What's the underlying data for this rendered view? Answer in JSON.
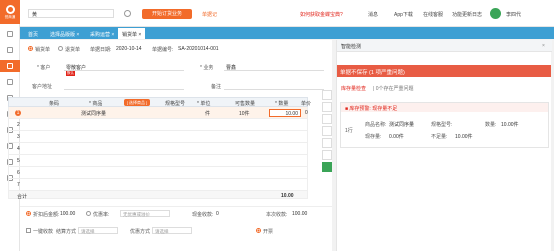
{
  "app": {
    "logo_text": "悦商通"
  },
  "topbar": {
    "search_value": "黄",
    "primary_button": "开始订货业务",
    "secondary_link": "单据记",
    "items": [
      {
        "label": "如何获取金蝶宝典?",
        "red": true
      },
      {
        "label": "消息"
      },
      {
        "label": "App下载"
      },
      {
        "label": "在线客服"
      },
      {
        "label": "功能更新日志"
      }
    ],
    "user_name": "李四代"
  },
  "tabs": [
    {
      "label": "首页",
      "active": false
    },
    {
      "label": "选择品版版 ×",
      "active": false
    },
    {
      "label": "采购运营 ×",
      "active": false
    },
    {
      "label": "销货单 ×",
      "active": true
    }
  ],
  "form": {
    "type_options": [
      {
        "label": "销货单",
        "selected": true
      },
      {
        "label": "退货单",
        "selected": false
      }
    ],
    "date_label": "单据日期:",
    "date_value": "2020-10-14",
    "number_label": "单据编号:",
    "number_value": "SA-20201014-001",
    "customer_label": "* 客户",
    "customer_value": "零散客户",
    "customer_badge": "默认",
    "salesperson_label": "* 业务",
    "salesperson_value": "曹鑫",
    "address_label": "客户地址",
    "remark_label": "备注"
  },
  "table": {
    "headers": [
      "",
      "条码",
      "* 商品",
      "规格型号",
      "* 单位",
      "可售数量",
      "* 数量",
      "单价"
    ],
    "select_button": "[ 选择商品 ]",
    "rows": [
      {
        "index": "1",
        "product": "测试同序量",
        "unit": "件",
        "available": "10件",
        "qty": "10.00",
        "price": "0",
        "highlight": true
      },
      {
        "index": "2"
      },
      {
        "index": "3"
      },
      {
        "index": "4"
      },
      {
        "index": "5"
      },
      {
        "index": "6"
      },
      {
        "index": "7"
      }
    ],
    "total_label": "合计",
    "total_qty": "10.00"
  },
  "bottom": {
    "discount_amount_label": "折扣后金额:",
    "discount_amount_value": "100.00",
    "discount_rate_label": "优惠率:",
    "discount_value_label": "优惠金额:",
    "discount_placeholder": "无优惠或溢价",
    "receipt_label": "现金收款:",
    "receipt_value": "0",
    "received_label": "本次收款:",
    "received_value": "100.00",
    "one_click_label": "一键收款",
    "settle_label": "结算方式",
    "settle_placeholder": "请选择",
    "discount_type_label": "优惠方式",
    "discount_type_placeholder": "请选择",
    "invoice_label": "开票"
  },
  "panel": {
    "title": "智能检测",
    "alert_title": "单据不保存 (1 项严重问题)",
    "issue_link": "库存量检查",
    "issue_detail": "| 0个存在严重问题",
    "card": {
      "head": "■ 库存预警: 现存量不足",
      "row_index": "1行",
      "product_label": "商品名称:",
      "product_value": "测试同序量",
      "spec_label": "规格型号:",
      "spec_value": "",
      "qty_label": "数量:",
      "qty_value": "10.00件",
      "stock_label": "现存量:",
      "stock_value": "0.00件",
      "shortage_label": "不足量:",
      "shortage_value": "10.00件"
    }
  },
  "colors": {
    "accent": "#f26b2a",
    "tabbar": "#3d9fd3",
    "danger": "#e85c44",
    "success": "#3aa457"
  }
}
